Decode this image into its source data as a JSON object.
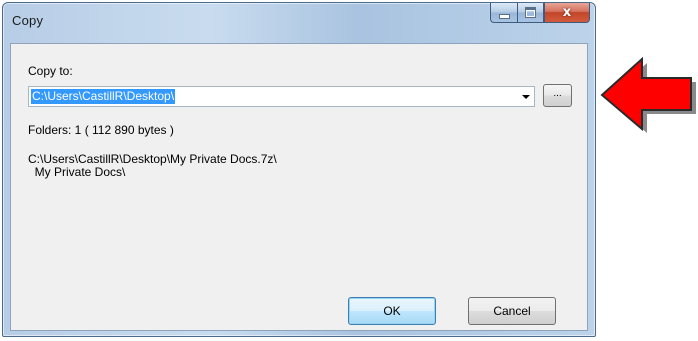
{
  "window": {
    "title": "Copy",
    "close_glyph": "x"
  },
  "dialog": {
    "copy_to_label": "Copy to:",
    "destination_value": "C:\\Users\\CastillR\\Desktop\\",
    "browse_label": "...",
    "folders_info": "Folders: 1    ( 112 890 bytes )",
    "path_line_1": "C:\\Users\\CastillR\\Desktop\\My Private Docs.7z\\",
    "path_line_2": "  My Private Docs\\",
    "ok_label": "OK",
    "cancel_label": "Cancel"
  },
  "annotation": {
    "arrow_color": "#ff0000",
    "arrow_icon": "left-arrow"
  }
}
